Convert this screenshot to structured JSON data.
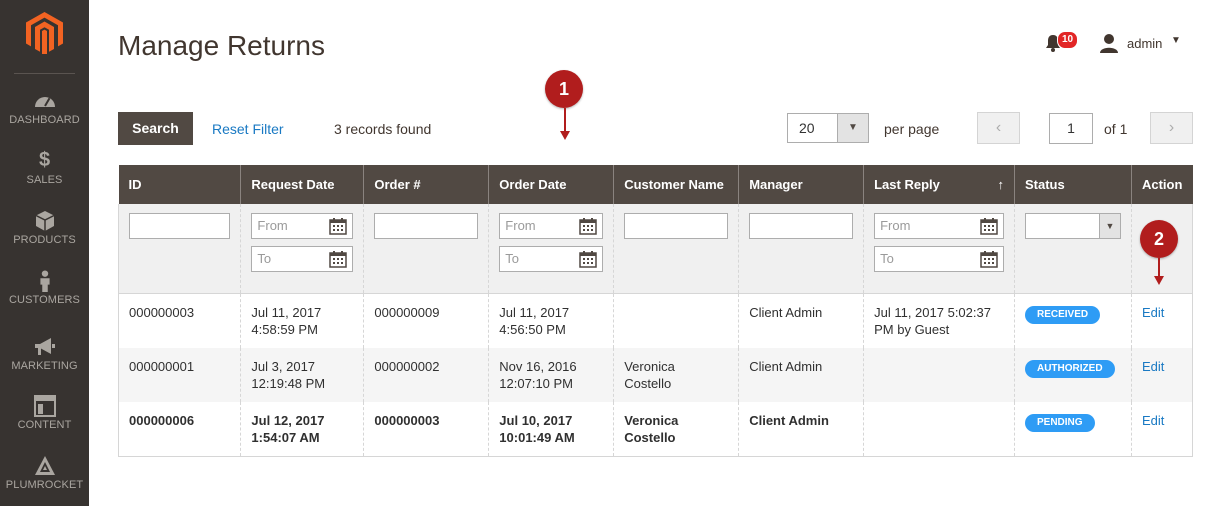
{
  "sidebar": {
    "items": [
      {
        "label": "DASHBOARD",
        "icon": "dashboard-icon"
      },
      {
        "label": "SALES",
        "icon": "dollar-icon"
      },
      {
        "label": "PRODUCTS",
        "icon": "box-icon"
      },
      {
        "label": "CUSTOMERS",
        "icon": "person-icon"
      },
      {
        "label": "MARKETING",
        "icon": "megaphone-icon"
      },
      {
        "label": "CONTENT",
        "icon": "layout-icon"
      },
      {
        "label": "PLUMROCKET",
        "icon": "plumrocket-icon"
      }
    ]
  },
  "header": {
    "title": "Manage Returns",
    "notifications_count": "10",
    "user_name": "admin"
  },
  "toolbar": {
    "search_label": "Search",
    "reset_label": "Reset Filter",
    "records_text": "3 records found",
    "per_page_value": "20",
    "per_page_label": "per page",
    "page_current": "1",
    "page_of": "of 1"
  },
  "callouts": {
    "one": "1",
    "two": "2"
  },
  "grid": {
    "columns": [
      "ID",
      "Request Date",
      "Order #",
      "Order Date",
      "Customer Name",
      "Manager",
      "Last Reply",
      "Status",
      "Action"
    ],
    "sorted_column_arrow": "↑",
    "filter_from": "From",
    "filter_to": "To",
    "rows": [
      {
        "id": "000000003",
        "request_date_1": "Jul 11, 2017",
        "request_date_2": "4:58:59 PM",
        "order": "000000009",
        "order_date_1": "Jul 11, 2017",
        "order_date_2": "4:56:50 PM",
        "customer_1": "",
        "customer_2": "",
        "manager": "Client Admin",
        "last_reply_1": "Jul 11, 2017 5:02:37",
        "last_reply_2": "PM by Guest",
        "status": "RECEIVED",
        "action": "Edit"
      },
      {
        "id": "000000001",
        "request_date_1": "Jul 3, 2017",
        "request_date_2": "12:19:48 PM",
        "order": "000000002",
        "order_date_1": "Nov 16, 2016",
        "order_date_2": "12:07:10 PM",
        "customer_1": "Veronica",
        "customer_2": "Costello",
        "manager": "Client Admin",
        "last_reply_1": "",
        "last_reply_2": "",
        "status": "AUTHORIZED",
        "action": "Edit"
      },
      {
        "id": "000000006",
        "request_date_1": "Jul 12, 2017",
        "request_date_2": "1:54:07 AM",
        "order": "000000003",
        "order_date_1": "Jul 10, 2017",
        "order_date_2": "10:01:49 AM",
        "customer_1": "Veronica",
        "customer_2": "Costello",
        "manager": "Client Admin",
        "last_reply_1": "",
        "last_reply_2": "",
        "status": "PENDING",
        "action": "Edit"
      }
    ]
  },
  "colors": {
    "sidebar": "#373330",
    "header_bg": "#514943",
    "link": "#1979c3",
    "badge": "#2e9cf5",
    "callout": "#b11d1d"
  }
}
